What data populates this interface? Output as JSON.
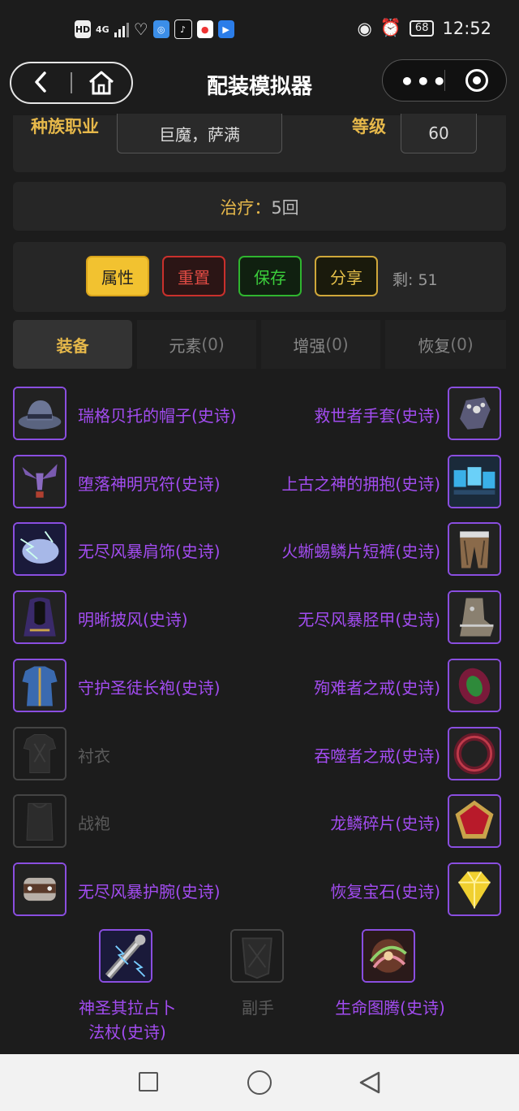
{
  "status_bar": {
    "left_icons": [
      "HD",
      "4G",
      "signal-icon",
      "health-icon",
      "browser-icon",
      "tiktok-icon",
      "map-icon",
      "video-icon"
    ],
    "battery": "68",
    "time": "12:52"
  },
  "header": {
    "title": "配装模拟器"
  },
  "info": {
    "race_class_label": "种族职业",
    "race_class_value": "巨魔，萨满",
    "level_label": "等级",
    "level_value": "60"
  },
  "heal": {
    "label": "治疗：",
    "value": "5回"
  },
  "actions": {
    "attr": "属性",
    "reset": "重置",
    "save": "保存",
    "share": "分享",
    "remain": "剩: 51"
  },
  "tabs": [
    {
      "label": "装备",
      "count": ""
    },
    {
      "label": "元素",
      "count": "(0)"
    },
    {
      "label": "增强",
      "count": "(0)"
    },
    {
      "label": "恢复",
      "count": "(0)"
    }
  ],
  "left_slots": [
    {
      "name": "瑞格贝托的帽子(史诗)",
      "icon": "hat-icon"
    },
    {
      "name": "堕落神明咒符(史诗)",
      "icon": "bird-charm-icon"
    },
    {
      "name": "无尽风暴肩饰(史诗)",
      "icon": "storm-shoulder-icon"
    },
    {
      "name": "明晰披风(史诗)",
      "icon": "cloak-icon"
    },
    {
      "name": "守护圣徒长袍(史诗)",
      "icon": "robe-icon"
    },
    {
      "name": "衬衣",
      "icon": "shirt-icon",
      "empty": true
    },
    {
      "name": "战袍",
      "icon": "tabard-icon",
      "empty": true
    },
    {
      "name": "无尽风暴护腕(史诗)",
      "icon": "bracer-icon"
    }
  ],
  "right_slots": [
    {
      "name": "救世者手套(史诗)",
      "icon": "gauntlet-icon"
    },
    {
      "name": "上古之神的拥抱(史诗)",
      "icon": "belt-icon"
    },
    {
      "name": "火蜥蜴鳞片短裤(史诗)",
      "icon": "pants-icon"
    },
    {
      "name": "无尽风暴胫甲(史诗)",
      "icon": "boots-icon"
    },
    {
      "name": "殉难者之戒(史诗)",
      "icon": "green-ring-icon"
    },
    {
      "name": "吞噬者之戒(史诗)",
      "icon": "red-ring-icon"
    },
    {
      "name": "龙鳞碎片(史诗)",
      "icon": "dragonscale-icon"
    },
    {
      "name": "恢复宝石(史诗)",
      "icon": "gem-icon"
    }
  ],
  "weapons": [
    {
      "name_line1": "神圣其拉占卜",
      "name_line2": "法杖(史诗)",
      "icon": "staff-icon"
    },
    {
      "name_line1": "副手",
      "name_line2": "",
      "icon": "offhand-icon",
      "empty": true
    },
    {
      "name_line1": "生命图腾(史诗)",
      "name_line2": "",
      "icon": "totem-icon"
    }
  ],
  "colors": {
    "epic": "#a24cf0",
    "accent_yellow": "#e6b84a",
    "reset_red": "#c9302c",
    "save_green": "#2fb52f"
  }
}
